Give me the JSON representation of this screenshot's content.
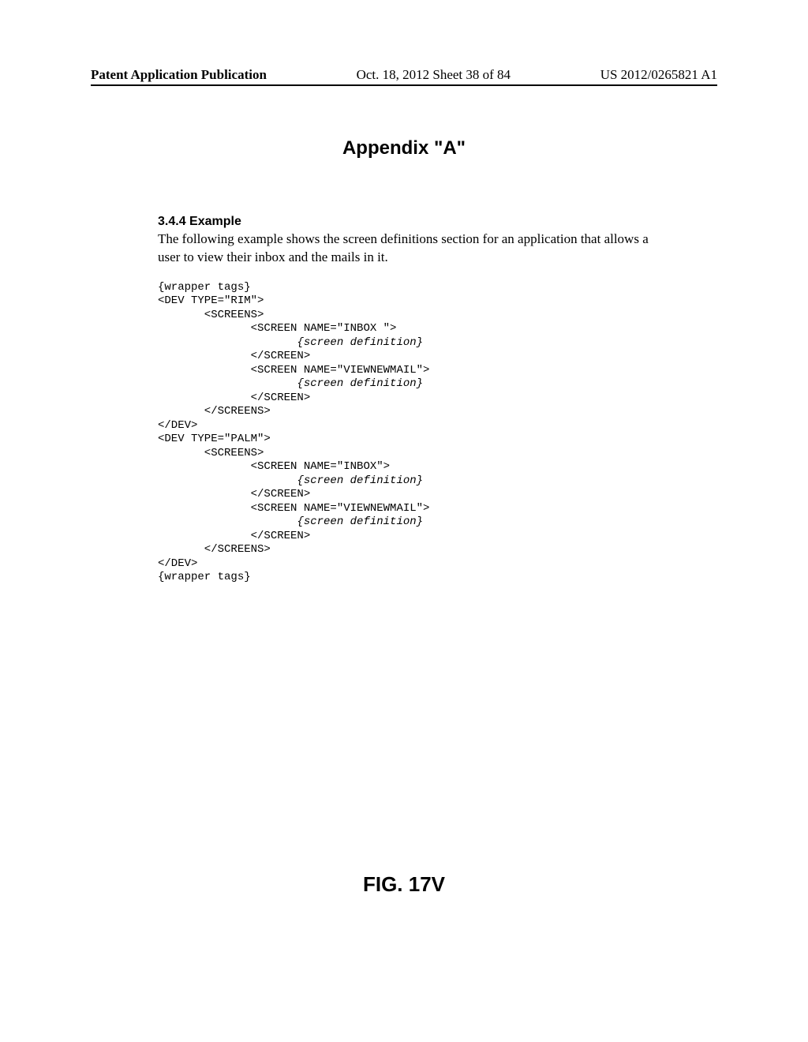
{
  "header": {
    "left": "Patent Application Publication",
    "center": "Oct. 18, 2012  Sheet 38 of 84",
    "right": "US 2012/0265821 A1"
  },
  "appendix_title": "Appendix \"A\"",
  "section": {
    "number_title": "3.4.4  Example",
    "paragraph": "The following example shows the screen definitions section for an application that allows a user to view their inbox and the mails in it."
  },
  "code": {
    "l01": "{wrapper tags}",
    "l02": "<DEV TYPE=\"RIM\">",
    "l03": "       <SCREENS>",
    "l04": "              <SCREEN NAME=\"INBOX \">",
    "l05i": "                     {screen definition}",
    "l06": "              </SCREEN>",
    "l07": "              <SCREEN NAME=\"VIEWNEWMAIL\">",
    "l08i": "                     {screen definition}",
    "l09": "              </SCREEN>",
    "l10": "       </SCREENS>",
    "l11": "</DEV>",
    "l12": "<DEV TYPE=\"PALM\">",
    "l13": "       <SCREENS>",
    "l14": "              <SCREEN NAME=\"INBOX\">",
    "l15i": "                     {screen definition}",
    "l16": "              </SCREEN>",
    "l17": "              <SCREEN NAME=\"VIEWNEWMAIL\">",
    "l18i": "                     {screen definition}",
    "l19": "              </SCREEN>",
    "l20": "       </SCREENS>",
    "l21": "</DEV>",
    "l22": "{wrapper tags}"
  },
  "figure_label": "FIG. 17V"
}
